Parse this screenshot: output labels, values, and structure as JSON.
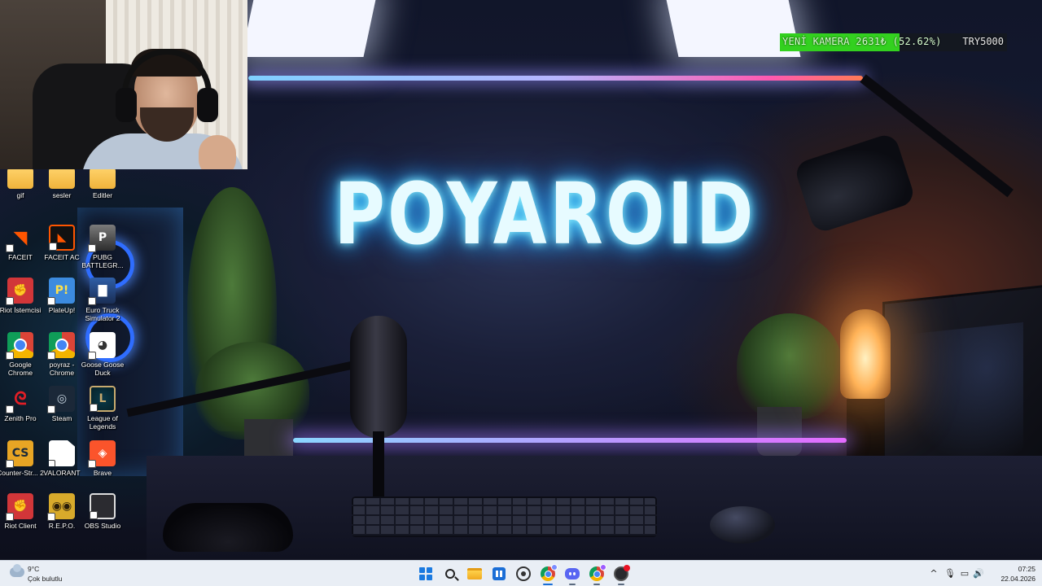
{
  "wallpaper": {
    "logo_text": "POYAROID"
  },
  "stream_overlay": {
    "goal_label": "YENİ KAMERA  2631₺ (52.62%)",
    "goal_progress": 0.5262,
    "goal_target": "TRY5000",
    "fill_color": "#33d11f"
  },
  "desktop_icons": [
    {
      "label": "gif",
      "icon": "folder-icon"
    },
    {
      "label": "sesler",
      "icon": "folder-icon"
    },
    {
      "label": "Editler",
      "icon": "folder-icon"
    },
    {
      "label": "FACEIT",
      "icon": "faceit-icon"
    },
    {
      "label": "FACEIT AC",
      "icon": "faceit-ac-icon"
    },
    {
      "label": "PUBG BATTLEGR...",
      "icon": "pubg-icon"
    },
    {
      "label": "Riot İstemcisi",
      "icon": "riot-client-icon"
    },
    {
      "label": "PlateUp!",
      "icon": "plateup-icon"
    },
    {
      "label": "Euro Truck Simulator 2",
      "icon": "euro-truck-icon"
    },
    {
      "label": "Google Chrome",
      "icon": "chrome-icon"
    },
    {
      "label": "poyraz - Chrome",
      "icon": "chrome-profile-icon"
    },
    {
      "label": "Goose Goose Duck",
      "icon": "goose-icon"
    },
    {
      "label": "Zenith Pro",
      "icon": "zenith-icon"
    },
    {
      "label": "Steam",
      "icon": "steam-icon"
    },
    {
      "label": "League of Legends",
      "icon": "league-icon"
    },
    {
      "label": "Counter-Str... 2",
      "icon": "counter-strike-icon"
    },
    {
      "label": "VALORANT",
      "icon": "file-icon"
    },
    {
      "label": "Brave",
      "icon": "brave-icon"
    },
    {
      "label": "Riot Client",
      "icon": "riot-client-icon"
    },
    {
      "label": "R.E.P.O.",
      "icon": "repo-icon"
    },
    {
      "label": "OBS Studio",
      "icon": "obs-icon"
    }
  ],
  "taskbar": {
    "weather_temp": "9°C",
    "weather_desc": "Çok bulutlu",
    "pinned": [
      {
        "name": "start-button",
        "icon": "windows-icon"
      },
      {
        "name": "search-button",
        "icon": "search-icon"
      },
      {
        "name": "file-explorer",
        "icon": "folder-icon"
      },
      {
        "name": "microsoft-store",
        "icon": "store-icon"
      },
      {
        "name": "whatsapp",
        "icon": "whatsapp-icon"
      },
      {
        "name": "chrome",
        "icon": "chrome-icon"
      },
      {
        "name": "discord",
        "icon": "discord-icon"
      },
      {
        "name": "chrome-profile",
        "icon": "chrome-icon"
      },
      {
        "name": "obs-studio",
        "icon": "obs-icon"
      }
    ],
    "tray_chevron": "^",
    "clock_time": "07:25",
    "clock_date": "22.04.2026"
  }
}
